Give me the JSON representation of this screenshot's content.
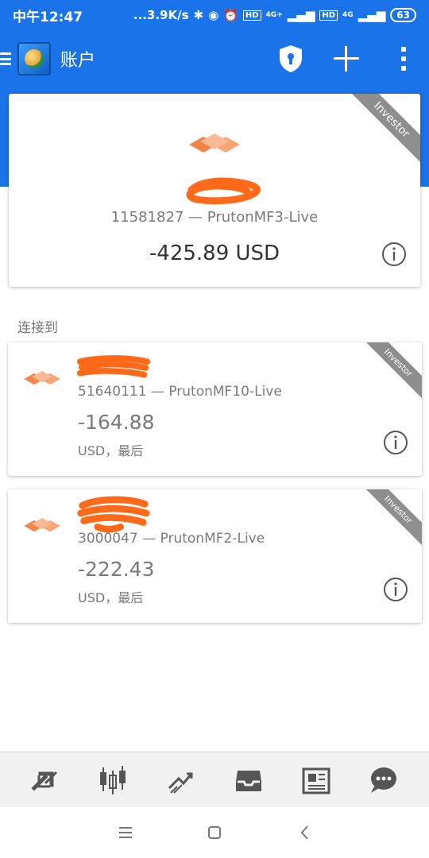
{
  "status_bar": {
    "time": "中午12:47",
    "net_speed": "...3.9K/s",
    "hd1": "HD",
    "sig1": "4G+",
    "hd2": "HD",
    "sig2": "4G",
    "battery": "63"
  },
  "app_bar": {
    "title": "账户"
  },
  "main_account": {
    "ribbon": "Investor",
    "account_line": "11581827 — PrutonMF3-Live",
    "balance": "-425.89 USD"
  },
  "section": {
    "connected_label": "连接到"
  },
  "accounts": [
    {
      "ribbon": "Investor",
      "account_line": "51640111 — PrutonMF10-Live",
      "balance": "-164.88",
      "currency_line": "USD，最后"
    },
    {
      "ribbon": "Investor",
      "account_line": "3000047 — PrutonMF2-Live",
      "balance": "-222.43",
      "currency_line": "USD，最后"
    }
  ],
  "bottom_nav": [
    "quotes-icon",
    "chart-icon",
    "trade-icon",
    "history-icon",
    "news-icon",
    "chat-icon"
  ],
  "colors": {
    "primary": "#1a73e8",
    "brand_orange": "#f4854a",
    "redaction": "#ff6a1a"
  }
}
